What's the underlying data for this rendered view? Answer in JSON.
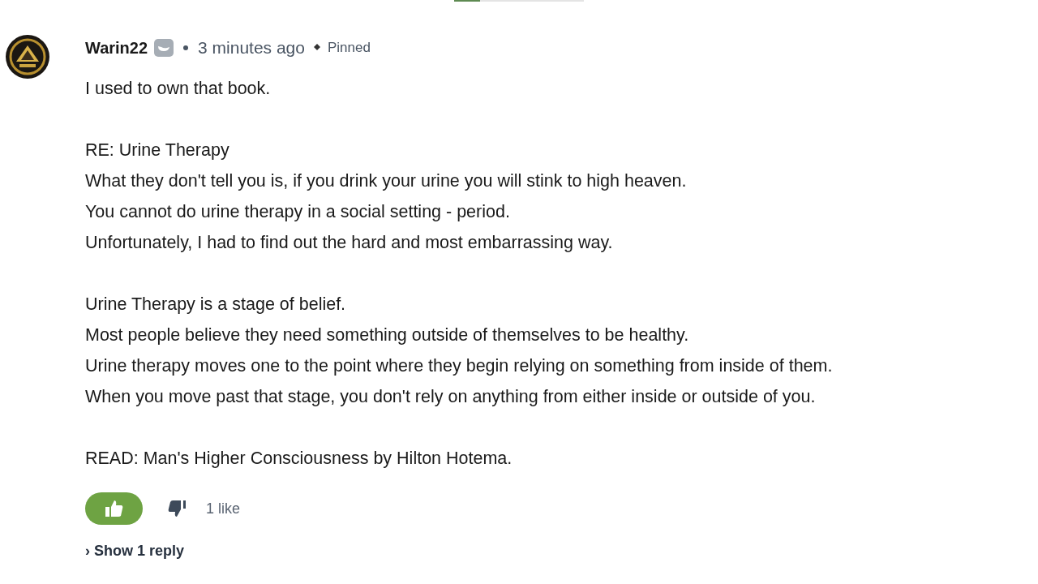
{
  "top_progress": {
    "level": 0.2
  },
  "comment": {
    "author": "Warin22",
    "timestamp": "3 minutes ago",
    "pinned": true,
    "pinned_label": "Pinned",
    "paragraphs": [
      [
        "I used to own that book."
      ],
      [
        "RE: Urine Therapy",
        "What they don't tell you is, if you drink your urine you will stink to high heaven.",
        "You cannot do urine therapy in a social setting - period.",
        "Unfortunately, I had to find out the hard and most embarrassing way."
      ],
      [
        "Urine Therapy is a stage of belief.",
        "Most people believe they need something outside of themselves to be healthy.",
        "Urine therapy moves one to the point where they begin relying on something from inside of them.",
        "When you move past that stage, you don't rely on anything from either inside or outside of you."
      ],
      [
        "READ: Man's Higher Consciousness by Hilton Hotema."
      ]
    ],
    "liked": true,
    "like_count": "1 like",
    "replies_link": "› Show 1 reply"
  }
}
